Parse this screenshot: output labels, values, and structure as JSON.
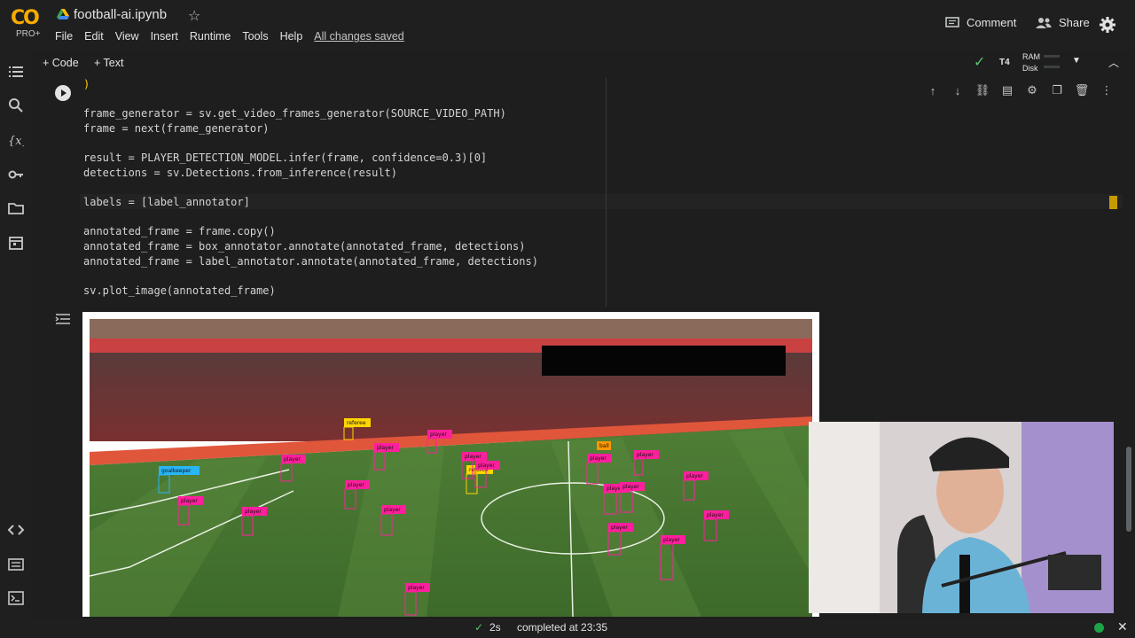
{
  "app": {
    "logo_text": "CO",
    "logo_sub": "PRO+",
    "notebook_title": "football-ai.ipynb"
  },
  "menu": {
    "items": [
      "File",
      "Edit",
      "View",
      "Insert",
      "Runtime",
      "Tools",
      "Help"
    ],
    "saved_status": "All changes saved"
  },
  "header_actions": {
    "comment_label": "Comment",
    "share_label": "Share"
  },
  "toolbar": {
    "add_code_label": "+ Code",
    "add_text_label": "+ Text",
    "runtime_type": "T4",
    "ram_label": "RAM",
    "disk_label": "Disk"
  },
  "cell": {
    "code_lines": [
      ")",
      "",
      "frame_generator = sv.get_video_frames_generator(SOURCE_VIDEO_PATH)",
      "frame = next(frame_generator)",
      "",
      "result = PLAYER_DETECTION_MODEL.infer(frame, confidence=0.3)[0]",
      "detections = sv.Detections.from_inference(result)",
      "",
      "labels = [label_annotator]",
      "",
      "annotated_frame = frame.copy()",
      "annotated_frame = box_annotator.annotate(annotated_frame, detections)",
      "annotated_frame = label_annotator.annotate(annotated_frame, detections)",
      "",
      "sv.plot_image(annotated_frame)"
    ]
  },
  "detections": {
    "goalkeeper_label": "goalkeeper",
    "player_label": "player",
    "referee_label": "referee",
    "ball_label": "ball",
    "colors": {
      "player": "#ff1f9d",
      "goalkeeper": "#29b6f6",
      "referee": "#ffd600",
      "ball": "#ff9800"
    }
  },
  "status": {
    "elapsed": "2s",
    "completed_text": "completed at 23:35"
  },
  "theme": {
    "background": "#1e1e1e",
    "accent_orange": "#f9ab00",
    "ok_green": "#5ec26a"
  }
}
